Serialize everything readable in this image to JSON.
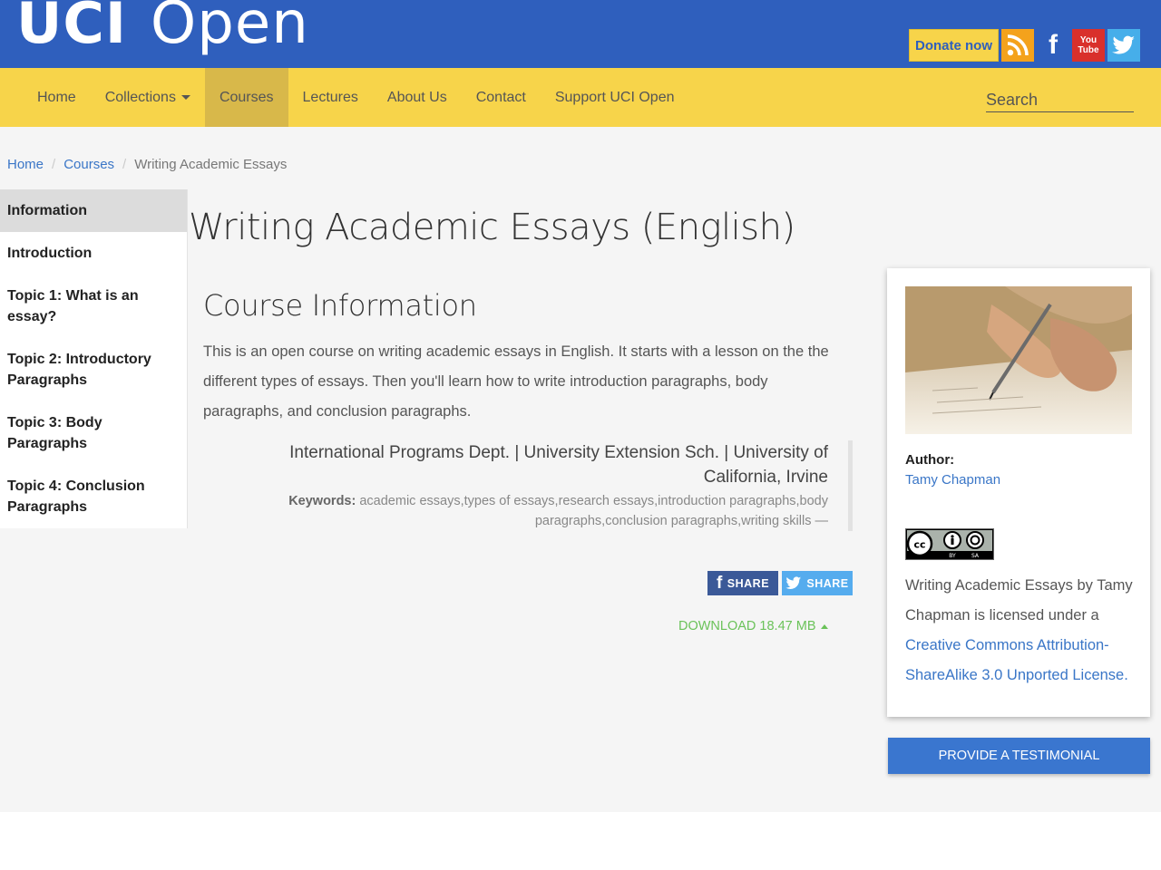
{
  "header": {
    "logo_uci": "UCI",
    "logo_open": "Open",
    "donate_label": "Donate now",
    "social": {
      "rss_icon": "rss-icon",
      "facebook_icon": "facebook-icon",
      "facebook_glyph": "f",
      "youtube_icon": "youtube-icon",
      "youtube_line1": "You",
      "youtube_line2": "Tube",
      "twitter_icon": "twitter-icon"
    }
  },
  "nav": {
    "items": [
      {
        "label": "Home"
      },
      {
        "label": "Collections"
      },
      {
        "label": "Courses"
      },
      {
        "label": "Lectures"
      },
      {
        "label": "About Us"
      },
      {
        "label": "Contact"
      },
      {
        "label": "Support UCI Open"
      }
    ],
    "active": "Courses",
    "search_placeholder": "Search"
  },
  "breadcrumb": {
    "home": "Home",
    "sep1": "/",
    "courses": "Courses",
    "sep2": "/",
    "current": "Writing Academic Essays"
  },
  "sidebar": {
    "items": [
      {
        "label": "Information"
      },
      {
        "label": "Introduction"
      },
      {
        "label": "Topic 1: What is an essay?"
      },
      {
        "label": "Topic 2: Introductory Paragraphs"
      },
      {
        "label": "Topic 3: Body Paragraphs"
      },
      {
        "label": "Topic 4: Conclusion Paragraphs"
      }
    ]
  },
  "main": {
    "title": "Writing Academic Essays (English)",
    "section_title": "Course Information",
    "description": "This is an open course on writing academic essays in English. It starts with a lesson on the the different types of essays. Then you'll learn how to write introduction paragraphs, body paragraphs, and conclusion paragraphs.",
    "affiliation": "International Programs Dept. | University Extension Sch. | University of California, Irvine",
    "keywords_label": "Keywords:",
    "keywords": "academic essays,types of essays,research essays,introduction paragraphs,body paragraphs,conclusion paragraphs,writing skills —",
    "share_fb_glyph": "f",
    "share_fb_label": "SHARE",
    "share_tw_label": "SHARE",
    "download_label": "DOWNLOAD 18.47 MB"
  },
  "card": {
    "author_label": "Author:",
    "author_name": "Tamy Chapman",
    "cc_label": "cc",
    "cc_by": "BY",
    "cc_sa": "SA",
    "license_prefix": "Writing Academic Essays by Tamy Chapman is licensed under a ",
    "license_link": "Creative Commons Attribution-ShareAlike 3.0 Unported License.",
    "testimonial_label": "PROVIDE A TESTIMONIAL"
  },
  "colors": {
    "header_blue": "#2f5fbd",
    "nav_yellow": "#f7d44a",
    "link_blue": "#3a76c7",
    "download_green": "#6ac259"
  }
}
